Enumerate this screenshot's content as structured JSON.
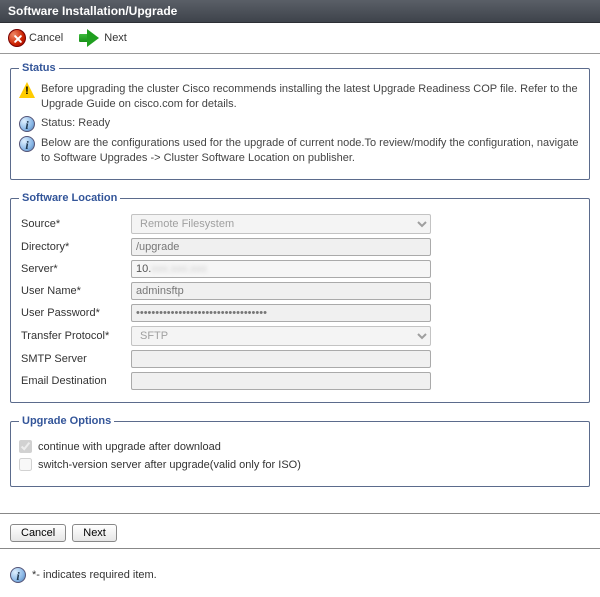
{
  "title": "Software Installation/Upgrade",
  "toolbar": {
    "cancel": "Cancel",
    "next": "Next"
  },
  "status": {
    "legend": "Status",
    "warning": "Before upgrading the cluster Cisco recommends installing the latest Upgrade Readiness COP file. Refer to the Upgrade Guide on cisco.com for details.",
    "status_label": "Status: Ready",
    "info": "Below are the configurations used for the upgrade of current node.To review/modify the configuration, navigate to Software Upgrades -> Cluster Software Location on publisher."
  },
  "location": {
    "legend": "Software Location",
    "source_label": "Source",
    "source_value": "Remote Filesystem",
    "directory_label": "Directory",
    "directory_value": "/upgrade",
    "server_label": "Server",
    "server_prefix": "10.",
    "username_label": "User Name",
    "username_value": "adminsftp",
    "password_label": "User Password",
    "password_value": "••••••••••••••••••••••••••••••••••",
    "protocol_label": "Transfer Protocol",
    "protocol_value": "SFTP",
    "smtp_label": "SMTP Server",
    "smtp_value": "",
    "email_label": "Email Destination",
    "email_value": ""
  },
  "options": {
    "legend": "Upgrade Options",
    "continue_label": "continue with upgrade after download",
    "continue_checked": true,
    "switch_label": "switch-version server after upgrade(valid only for ISO)",
    "switch_checked": false
  },
  "buttons": {
    "cancel": "Cancel",
    "next": "Next"
  },
  "footnote": "*- indicates required item."
}
